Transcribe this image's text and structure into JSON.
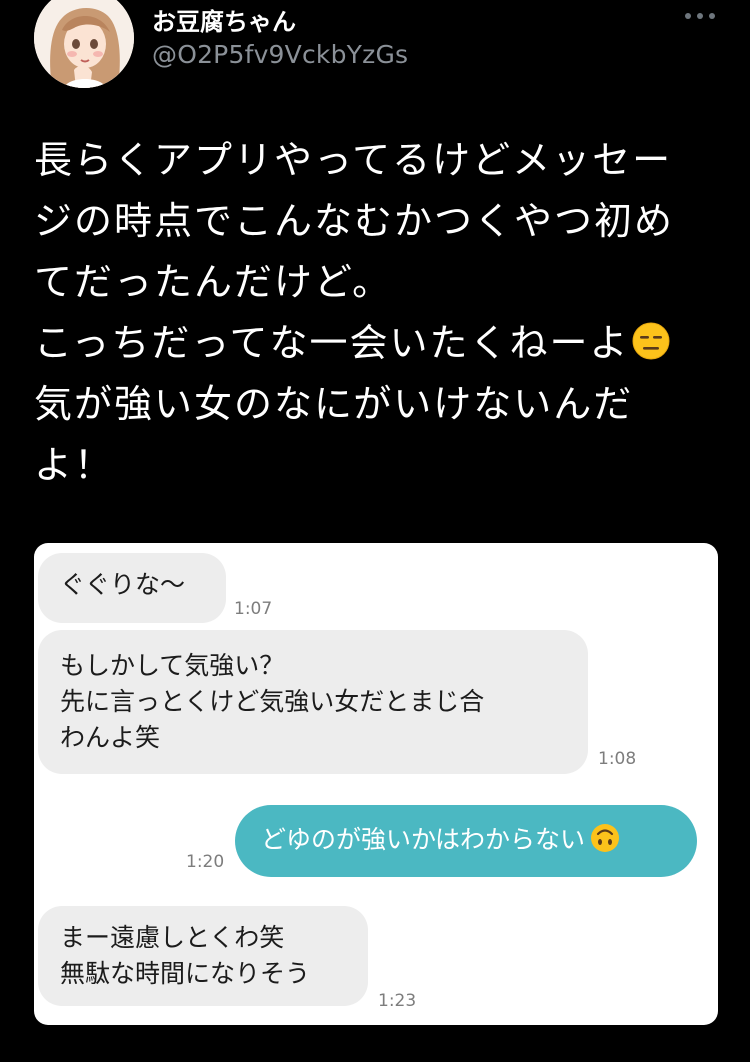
{
  "author": {
    "display_name": "お豆腐ちゃん",
    "handle": "@O2P5fv9VckbYzGs",
    "avatar_icon": "anime-girl-avatar-icon",
    "more_icon": "more-options-icon"
  },
  "tweet": {
    "text": "長らくアプリやってるけどメッセー\nジの時点でこんなむかつくやつ初め\nてだったんだけど。\nこっちだってな一会いたくねーよ",
    "text_after_emoji": "\n気が強い女のなにがいけないんだ\nよ！",
    "emoji": "expressionless-face-emoji"
  },
  "chat": {
    "messages": [
      {
        "direction": "incoming",
        "text": "ぐぐりな〜",
        "time": "1:07"
      },
      {
        "direction": "incoming",
        "text": "もしかして気強い？\n先に言っとくけど気強い女だとまじ合\nわんよ笑",
        "time": "1:08"
      },
      {
        "direction": "outgoing",
        "text": "どゆのが強いかはわからない",
        "emoji": "upside-down-face-emoji",
        "time": "1:20"
      },
      {
        "direction": "incoming",
        "text": "まー遠慮しとくわ笑\n無駄な時間になりそう",
        "time": "1:23"
      }
    ],
    "colors": {
      "incoming_bubble": "#ededed",
      "outgoing_bubble": "#4bb8c2",
      "card": "#ffffff"
    }
  }
}
